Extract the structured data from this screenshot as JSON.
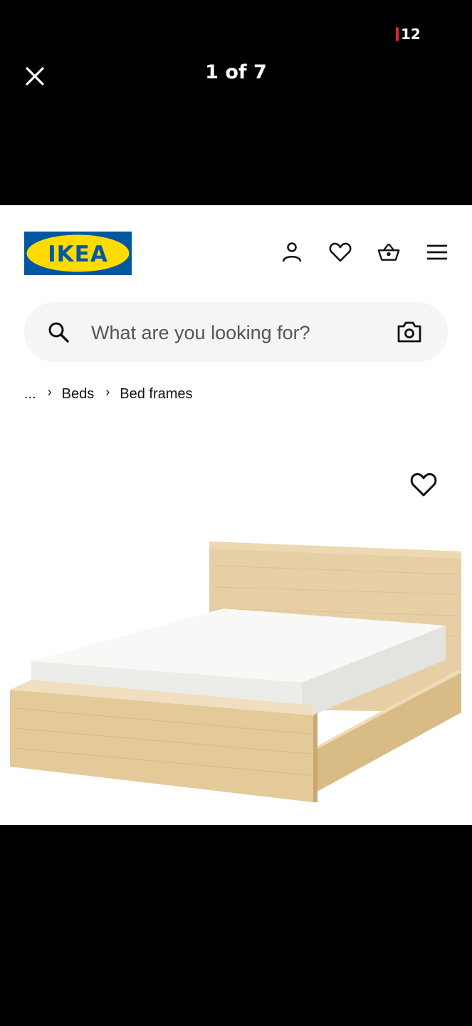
{
  "viewer": {
    "counter": "1 of 7",
    "status_count": "12"
  },
  "brand": {
    "logo_text": "IKEA",
    "logo_blue": "#0058a3",
    "logo_yellow": "#ffdb00"
  },
  "header": {
    "icons": [
      "account-icon",
      "heart-icon",
      "basket-icon",
      "menu-icon"
    ]
  },
  "search": {
    "placeholder": "What are you looking for?",
    "value": ""
  },
  "breadcrumb": {
    "items": [
      "...",
      "Beds",
      "Bed frames"
    ]
  }
}
